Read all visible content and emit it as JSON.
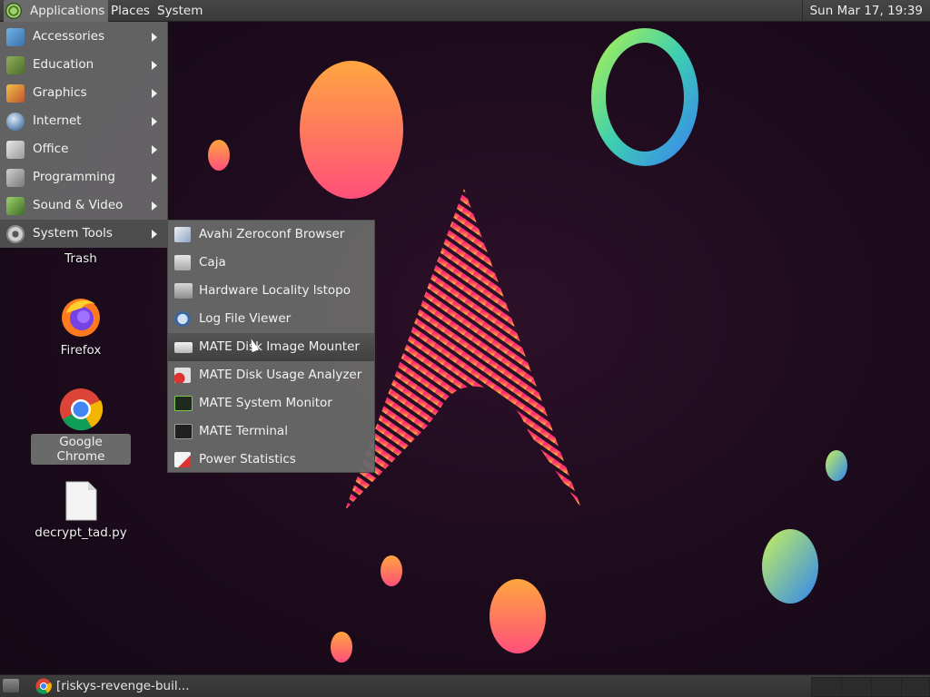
{
  "top_panel": {
    "applications": "Applications",
    "places": "Places",
    "system": "System",
    "clock": "Sun Mar 17, 19:39"
  },
  "applications_menu": {
    "categories": [
      {
        "label": "Accessories",
        "icon": "accessories-icon"
      },
      {
        "label": "Education",
        "icon": "education-icon"
      },
      {
        "label": "Graphics",
        "icon": "graphics-icon"
      },
      {
        "label": "Internet",
        "icon": "internet-icon"
      },
      {
        "label": "Office",
        "icon": "office-icon"
      },
      {
        "label": "Programming",
        "icon": "programming-icon"
      },
      {
        "label": "Sound & Video",
        "icon": "sound-video-icon"
      },
      {
        "label": "System Tools",
        "icon": "system-tools-icon"
      }
    ],
    "active_category": "System Tools"
  },
  "system_tools_menu": {
    "items": [
      {
        "label": "Avahi Zeroconf Browser",
        "icon": "avahi-icon"
      },
      {
        "label": "Caja",
        "icon": "file-manager-icon"
      },
      {
        "label": "Hardware Locality lstopo",
        "icon": "hardware-icon"
      },
      {
        "label": "Log File Viewer",
        "icon": "log-viewer-icon"
      },
      {
        "label": "MATE Disk Image Mounter",
        "icon": "disk-mounter-icon"
      },
      {
        "label": "MATE Disk Usage Analyzer",
        "icon": "disk-usage-icon"
      },
      {
        "label": "MATE System Monitor",
        "icon": "system-monitor-icon"
      },
      {
        "label": "MATE Terminal",
        "icon": "terminal-icon"
      },
      {
        "label": "Power Statistics",
        "icon": "power-stats-icon"
      }
    ],
    "hovered": "MATE Disk Image Mounter"
  },
  "desktop_icons": [
    {
      "label": "Trash",
      "icon": "trash-icon"
    },
    {
      "label": "Firefox",
      "icon": "firefox-icon"
    },
    {
      "label": "Google Chrome",
      "icon": "chrome-icon",
      "selected": true
    },
    {
      "label": "decrypt_tad.py",
      "icon": "file-icon"
    }
  ],
  "taskbar": {
    "window_title": "[riskys-revenge-buil..."
  },
  "colors": {
    "panel": "#3a3a3a",
    "menu_bg": "#696969",
    "menu_hover": "#4d4d4d",
    "desktop_bg": "#1c0b1c"
  }
}
